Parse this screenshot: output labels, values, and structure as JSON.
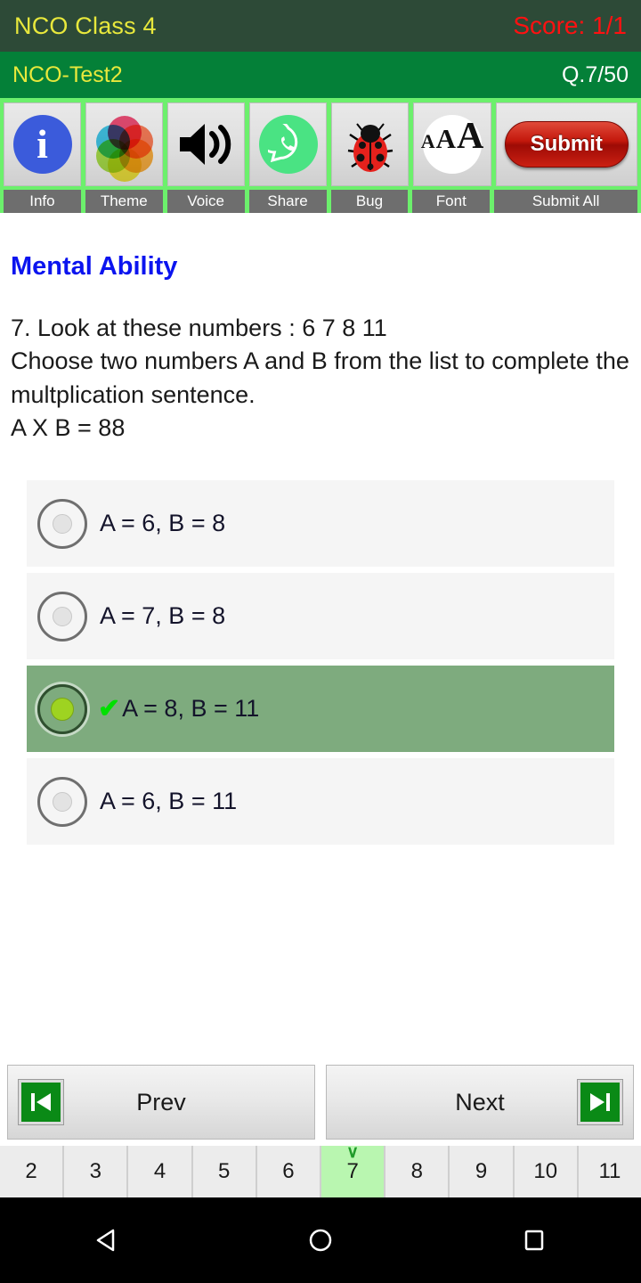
{
  "header": {
    "app_title": "NCO Class 4",
    "score": "Score: 1/1",
    "title_color": "#e8e83c",
    "score_color": "#ff1111",
    "bg_color": "#2d4a37"
  },
  "subheader": {
    "test_name": "NCO-Test2",
    "question_count": "Q.7/50",
    "bg_color": "#048038"
  },
  "toolbar": {
    "bg_color": "#6cf06c",
    "items": [
      {
        "label": "Info",
        "icon": "info-icon"
      },
      {
        "label": "Theme",
        "icon": "theme-palette-icon"
      },
      {
        "label": "Voice",
        "icon": "speaker-volume-icon"
      },
      {
        "label": "Share",
        "icon": "whatsapp-share-icon"
      },
      {
        "label": "Bug",
        "icon": "ladybug-icon"
      },
      {
        "label": "Font",
        "icon": "font-size-icon"
      },
      {
        "label": "Submit All",
        "icon": "submit-button-icon",
        "button_label": "Submit"
      }
    ]
  },
  "question": {
    "subject": "Mental Ability",
    "subject_color": "#0b14ef",
    "text": "7. Look at these numbers : 6 7 8 11\nChoose two numbers A and B from the list to complete the multplication sentence.\nA X B = 88"
  },
  "options": [
    {
      "label": "A = 6, B = 8",
      "selected": false
    },
    {
      "label": "A = 7, B = 8",
      "selected": false
    },
    {
      "label": "A = 8, B = 11",
      "selected": true,
      "tick": "✔"
    },
    {
      "label": "A = 6, B = 11",
      "selected": false
    }
  ],
  "nav": {
    "prev_label": "Prev",
    "next_label": "Next"
  },
  "pager": {
    "pages": [
      "2",
      "3",
      "4",
      "5",
      "6",
      "7",
      "8",
      "9",
      "10",
      "11"
    ],
    "current": "7",
    "current_bg": "#b9f6b0",
    "tick": "∨"
  },
  "android_nav": {
    "back": "back-triangle-icon",
    "home": "home-circle-icon",
    "recents": "recents-square-icon"
  }
}
